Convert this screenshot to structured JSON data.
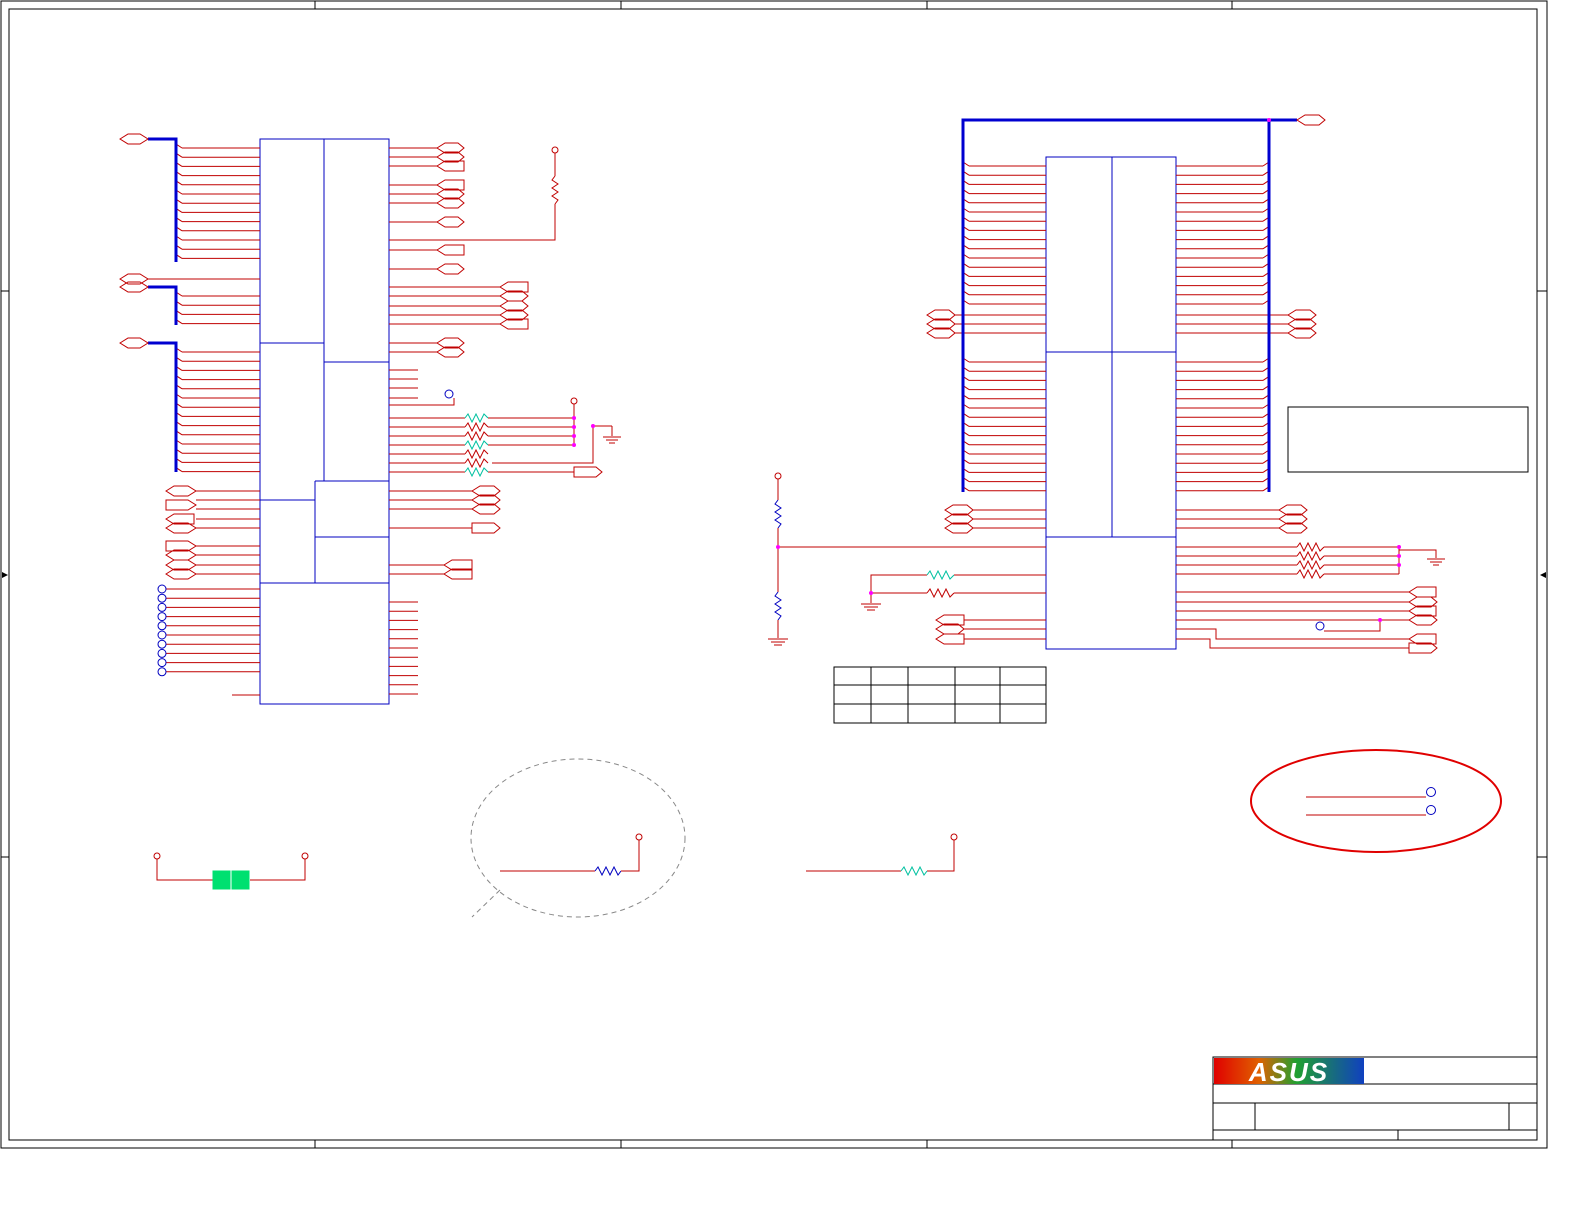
{
  "title_block": {
    "logo_text": "ASUS",
    "logo_colors": [
      "#e00000",
      "#e07000",
      "#20a020",
      "#1040c0"
    ]
  },
  "colors": {
    "frame": "#000000",
    "block": "#0000c0",
    "bus": "#0000d0",
    "wire": "#c00000",
    "net_resistor": "#00c0a0",
    "junction": "#ff00ff",
    "highlight_ellipse": "#e00000",
    "component_fill": "#00e070"
  }
}
